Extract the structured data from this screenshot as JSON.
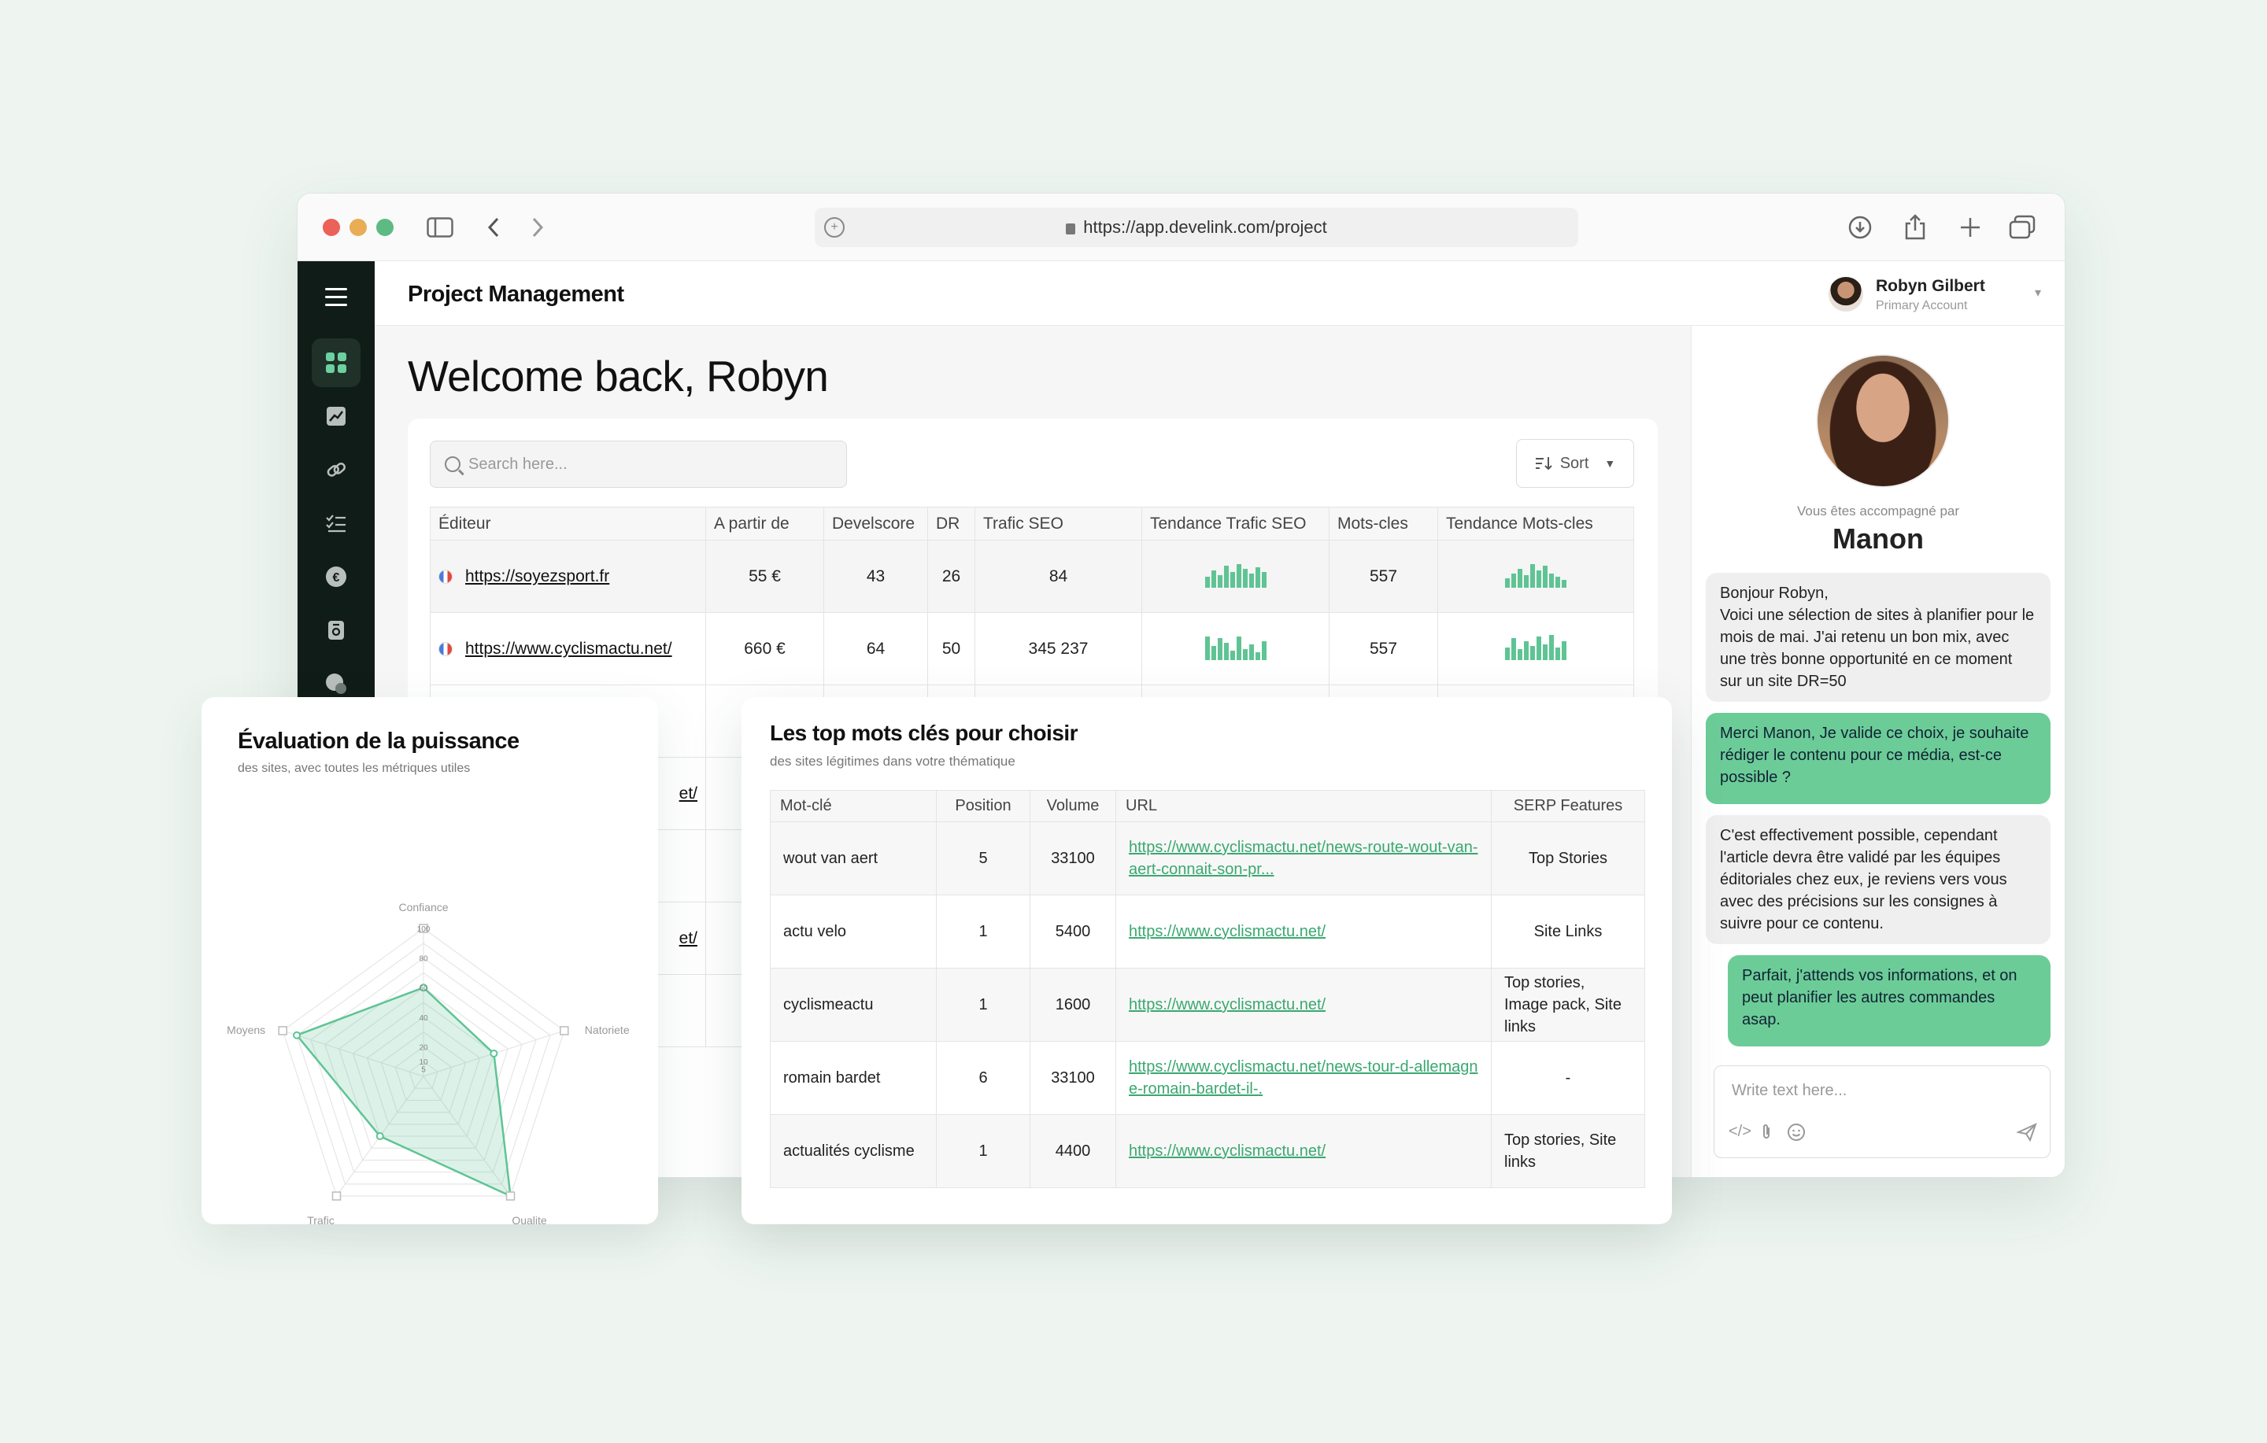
{
  "browser": {
    "url": "https://app.develink.com/project"
  },
  "app": {
    "title": "Project Management",
    "welcome": "Welcome back, Robyn",
    "user": {
      "name": "Robyn Gilbert",
      "role": "Primary Account"
    }
  },
  "sidebar": {
    "items": [
      "grid-icon",
      "chart-icon",
      "link-icon",
      "checklist-icon",
      "euro-icon",
      "document-icon",
      "chat-icon"
    ]
  },
  "search": {
    "placeholder": "Search here..."
  },
  "sort": {
    "label": "Sort"
  },
  "main_table": {
    "headers": [
      "Éditeur",
      "A partir de",
      "Develscore",
      "DR",
      "Trafic SEO",
      "Tendance Trafic SEO",
      "Mots-cles",
      "Tendance Mots-cles"
    ],
    "rows": [
      {
        "editor": "https://soyezsport.fr",
        "price": "55 €",
        "develscore": "43",
        "dr": "26",
        "trafic": "84",
        "mots": "557"
      },
      {
        "editor": "https://www.cyclismactu.net/",
        "price": "660 €",
        "develscore": "64",
        "dr": "50",
        "trafic": "345 237",
        "mots": "557"
      }
    ],
    "partial_rows": [
      "et/",
      "et/"
    ]
  },
  "chat": {
    "accompanied_by": "Vous êtes accompagné par",
    "advisor": "Manon",
    "messages": [
      {
        "from": "in",
        "text": "Bonjour Robyn,\nVoici une sélection de sites à planifier pour le mois de mai. J'ai retenu un bon mix, avec une très bonne opportunité en ce moment sur un site DR=50"
      },
      {
        "from": "out",
        "text": "Merci Manon, Je valide ce choix, je souhaite rédiger le contenu pour ce média, est-ce possible ?"
      },
      {
        "from": "in",
        "text": "C'est effectivement possible, cependant l'article devra être validé par les équipes éditoriales chez eux, je reviens vers vous avec des précisions sur les consignes à suivre pour ce contenu."
      },
      {
        "from": "out",
        "text": "Parfait, j'attends vos informations, et on peut planifier les autres commandes asap."
      }
    ],
    "compose_placeholder": "Write text here..."
  },
  "radar": {
    "title": "Évaluation de la puissance",
    "subtitle": "des sites, avec toutes les métriques utiles"
  },
  "chart_data": {
    "type": "radar",
    "categories": [
      "Confiance",
      "Natoriete",
      "Qualite",
      "Trafic",
      "Moyens"
    ],
    "values": [
      60,
      50,
      100,
      50,
      90
    ],
    "ticks": [
      "100",
      "80",
      "60",
      "40",
      "20",
      "10",
      "5"
    ],
    "ylim": [
      0,
      100
    ],
    "color": "#5fc494"
  },
  "keywords": {
    "title": "Les top mots clés pour choisir",
    "subtitle": "des sites légitimes dans votre thématique",
    "headers": [
      "Mot-clé",
      "Position",
      "Volume",
      "URL",
      "SERP Features"
    ],
    "rows": [
      {
        "kw": "wout van aert",
        "pos": "5",
        "vol": "33100",
        "url": "https://www.cyclismactu.net/news-route-wout-van-aert-connait-son-pr...",
        "serp": "Top Stories"
      },
      {
        "kw": "actu velo",
        "pos": "1",
        "vol": "5400",
        "url": "https://www.cyclismactu.net/",
        "serp": "Site Links"
      },
      {
        "kw": "cyclismeactu",
        "pos": "1",
        "vol": "1600",
        "url": "https://www.cyclismactu.net/",
        "serp": "Top stories, Image pack, Site links"
      },
      {
        "kw": "romain bardet",
        "pos": "6",
        "vol": "33100",
        "url": "https://www.cyclismactu.net/news-tour-d-allemagne-romain-bardet-il-.",
        "serp": "-"
      },
      {
        "kw": "actualités cyclisme",
        "pos": "1",
        "vol": "4400",
        "url": "https://www.cyclismactu.net/",
        "serp": "Top stories, Site links"
      }
    ]
  }
}
